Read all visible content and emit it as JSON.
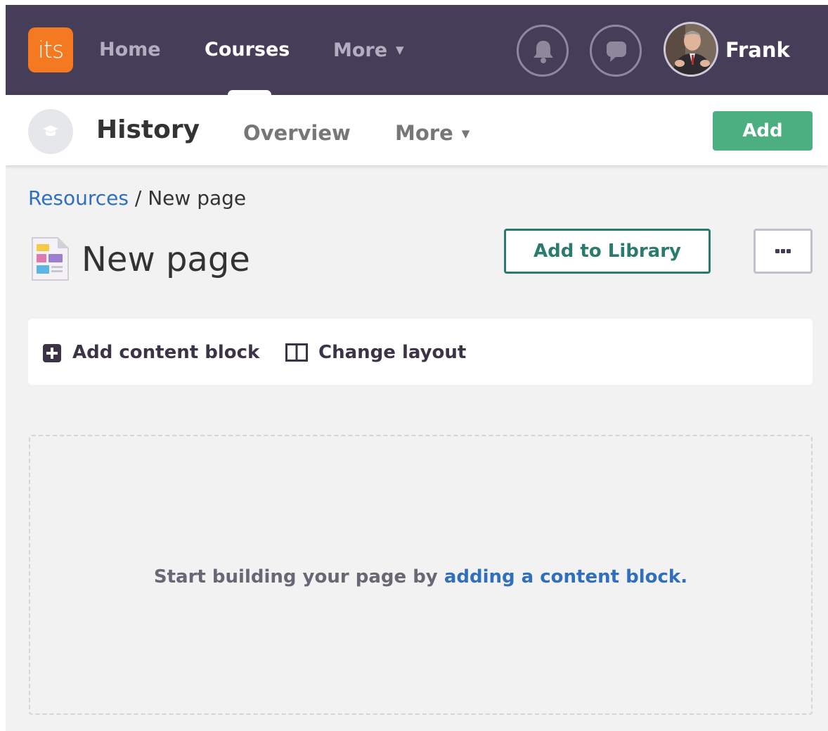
{
  "topnav": {
    "logo_text": "its",
    "items": [
      {
        "label": "Home"
      },
      {
        "label": "Courses"
      },
      {
        "label": "More"
      }
    ],
    "caret": "▼",
    "user": {
      "name": "Frank"
    }
  },
  "course": {
    "title": "History",
    "tabs": [
      {
        "label": "Overview"
      },
      {
        "label": "More"
      }
    ],
    "add_label": "Add"
  },
  "breadcrumb": {
    "parent": "Resources",
    "separator": " / ",
    "current": "New page"
  },
  "page": {
    "title": "New page",
    "add_to_library_label": "Add to Library"
  },
  "toolbar": {
    "add_block_label": "Add content block",
    "change_layout_label": "Change layout"
  },
  "dropzone": {
    "prompt": "Start building your page by ",
    "link_text": "adding a content block."
  },
  "colors": {
    "nav_background": "#463e59",
    "logo_orange": "#f47920",
    "add_green": "#4caf82",
    "library_teal": "#2b7a6e",
    "link_blue": "#2f6fbd",
    "page_background": "#f2f2f2"
  },
  "icons": {
    "bell": "bell-icon",
    "chat": "chat-icon",
    "course": "graduation-cap-icon",
    "page": "page-document-icon",
    "add_block": "plus-square-icon",
    "layout": "columns-icon",
    "more": "ellipsis-icon"
  }
}
